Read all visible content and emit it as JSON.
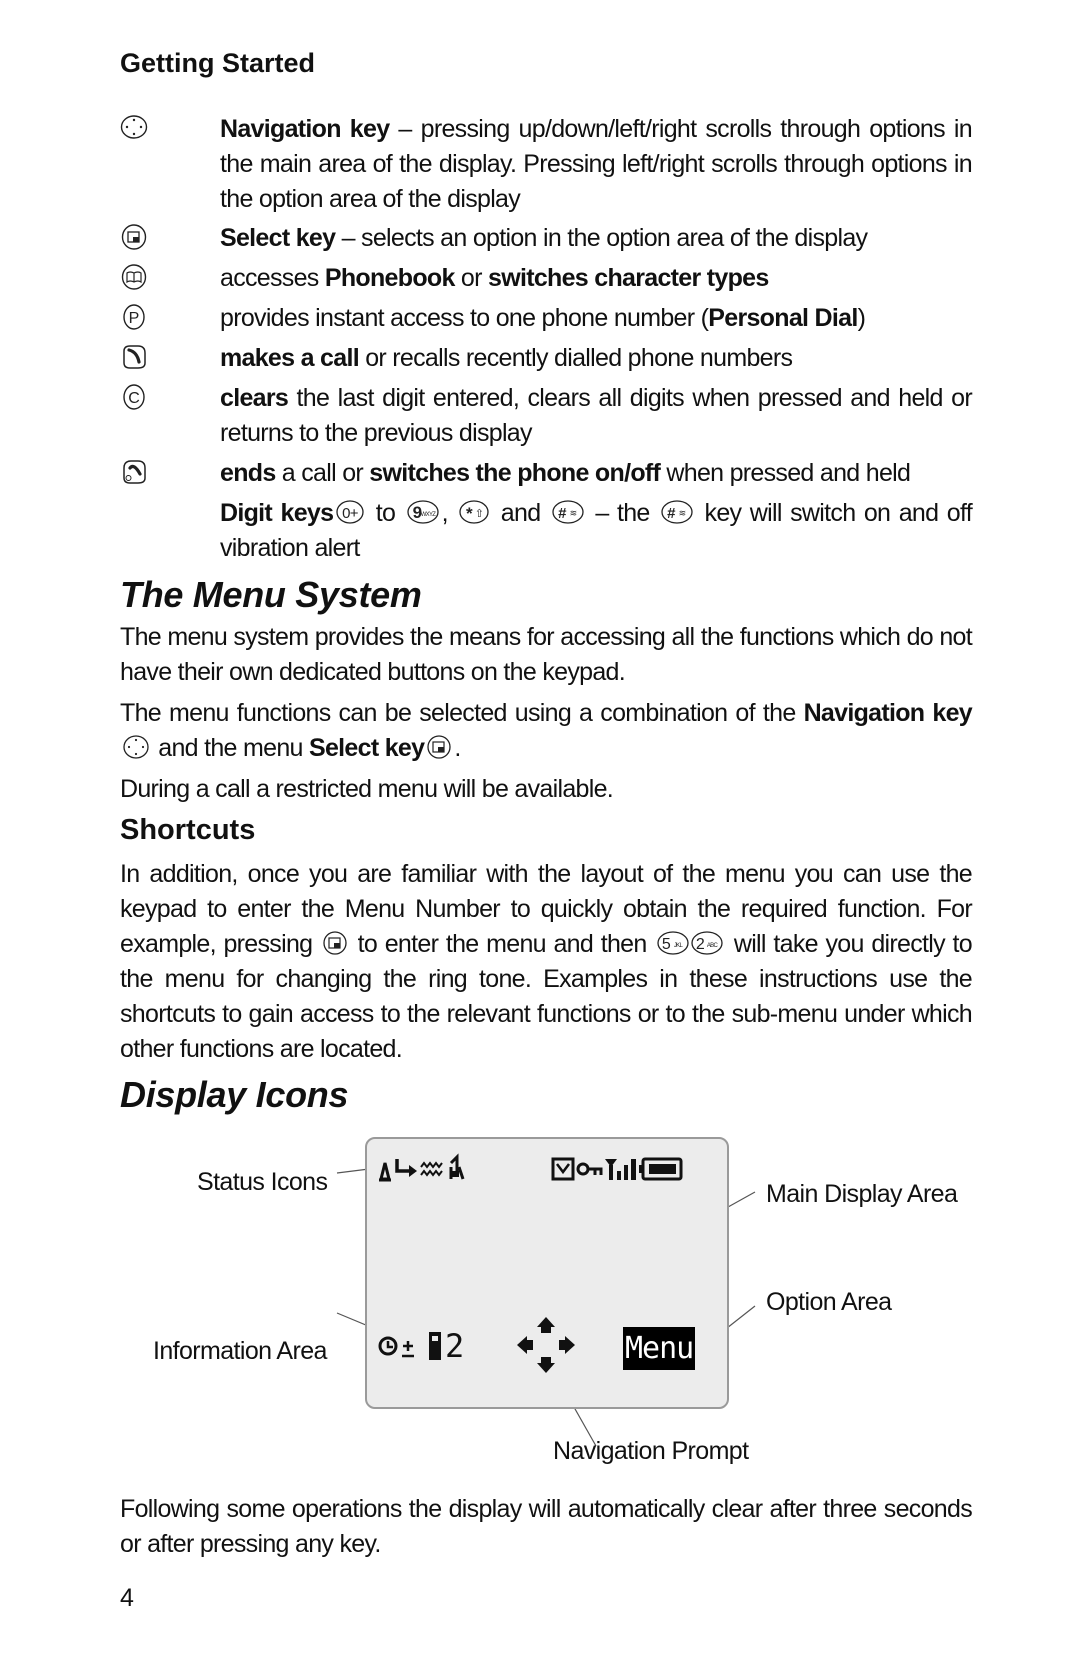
{
  "section_heading": "Getting Started",
  "keys": [
    {
      "icon": "navigation-key-icon",
      "bold": "Navigation key",
      "text": " – pressing up/down/left/right scrolls through options in the main area of the display. Pressing left/right scrolls through options in the option area of the display"
    },
    {
      "icon": "select-key-icon",
      "bold": "Select key",
      "text": " – selects an option in the option area of the display"
    },
    {
      "icon": "phonebook-key-icon",
      "pre": "accesses ",
      "bold": "Phonebook",
      "mid": " or ",
      "bold2": "switches character types"
    },
    {
      "icon": "personal-dial-key-icon",
      "pre": "provides instant access to one phone number (",
      "bold": "Personal Dial",
      "post": ")"
    },
    {
      "icon": "call-key-icon",
      "bold": "makes a call",
      "text": " or recalls recently dialled phone numbers"
    },
    {
      "icon": "clear-key-icon",
      "bold": "clears",
      "text": " the last digit entered, clears all digits when pressed and held or returns to the previous display"
    },
    {
      "icon": "end-key-icon",
      "bold": "ends",
      "mid": " a call or ",
      "bold2": "switches the phone on/off",
      "text": " when pressed and held"
    }
  ],
  "digit_keys": {
    "bold": "Digit keys",
    "to": " to ",
    "comma": ", ",
    "and": " and ",
    "the": " – the ",
    "rest": " key will switch on and off vibration alert",
    "key_labels": [
      "0+",
      "9WXYZ",
      "*⇧",
      "#≋"
    ]
  },
  "menu_system": {
    "title": "The Menu System",
    "p1": "The menu system provides the means for accessing all the functions which do not have their own dedicated buttons on the keypad.",
    "p2_pre": "The menu functions can be selected using a combination of the ",
    "p2_bold1": "Navigation key",
    "p2_mid": " and the menu ",
    "p2_bold2": "Select key",
    "p2_end": ".",
    "p3": "During a call a restricted menu will be available."
  },
  "shortcuts": {
    "title": "Shortcuts",
    "p_pre": "In addition, once you are familiar with the layout of the menu you can use the keypad to enter the Menu Number to quickly obtain the required function. For example, pressing ",
    "p_mid": " to enter the menu and then ",
    "p_post": " will take you directly to the menu for changing the ring tone. Examples in these instructions use the shortcuts to gain access to the relevant functions or to the sub-menu under which other functions are located.",
    "key_labels": [
      "5JKL",
      "2ABC"
    ]
  },
  "display_icons": {
    "title": "Display Icons",
    "callouts": {
      "status_icons": "Status Icons",
      "main_display_area": "Main Display Area",
      "option_area": "Option Area",
      "information_area": "Information Area",
      "navigation_prompt": "Navigation Prompt"
    },
    "lcd": {
      "info_number": "2",
      "option_label": "Menu"
    }
  },
  "footer_text": "Following some operations the display will automatically clear after three seconds or after pressing any key.",
  "page_number": "4"
}
